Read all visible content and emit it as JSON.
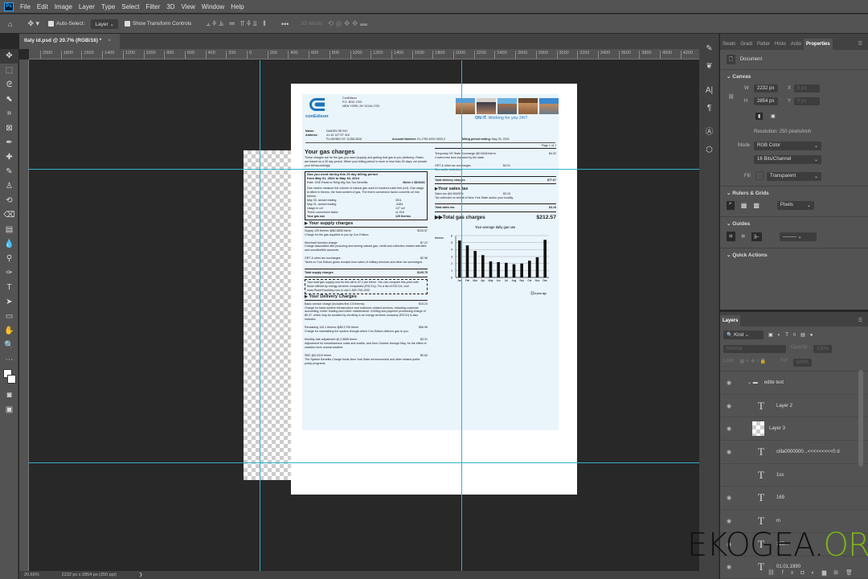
{
  "menu": [
    "File",
    "Edit",
    "Image",
    "Layer",
    "Type",
    "Select",
    "Filter",
    "3D",
    "View",
    "Window",
    "Help"
  ],
  "options": {
    "auto_select": "Auto-Select:",
    "layer_select": "Layer",
    "show_transform": "Show Transform Controls",
    "mode_3d": "3D Mode:",
    "more": "•••"
  },
  "doc_tab": {
    "title": "Italy id.psd @ 20.7% (RGB/16) *",
    "close": "×"
  },
  "ruler_top": [
    "2000",
    "1800",
    "1600",
    "1400",
    "1200",
    "1000",
    "800",
    "600",
    "400",
    "200",
    "0",
    "200",
    "400",
    "600",
    "800",
    "1000",
    "1200",
    "1400",
    "1600",
    "1800",
    "2000",
    "2200",
    "2400",
    "2600",
    "2800",
    "3000",
    "3200",
    "3400",
    "3600",
    "3800",
    "4000",
    "4200"
  ],
  "status": {
    "zoom": "20.66%",
    "size": "2232 px x 2854 px (250 ppi)",
    "arrow": "❯"
  },
  "bill": {
    "company": "ConEdison",
    "pobox": "P.O. BOX 1702",
    "city": "NEW YORK, NY 10116-1702",
    "logo": "conEdison",
    "slogan_bold": "ON IT.",
    "slogan": "Working for you 24/7.",
    "name_label": "Name:",
    "name": "DAIDEN SE INC",
    "address_label": "Address:",
    "address1": "41-43 147 ST 418",
    "address2": "FLUSHING NY 11358-2626",
    "account_label": "Account Number:",
    "account": "01-1750-4002-0003-0",
    "billing_label": "Billing period ending:",
    "billing": "May 30, 2024",
    "page": "Page 1 of 1",
    "gas_title": "Your gas charges",
    "gas_intro": "These charges are for the gas you used (supply) and getting that gas to you (delivery). Rates are based on a 30 day period. When your billing period is more or less than 30 days, we prorate your bill accordingly.",
    "box": {
      "title1": "Gas you used during this 29 day billing period",
      "title2": "from May 01, 2024 to May 30, 2024",
      "rate": "Rate: GSE Resid or Relig Htg Svc Svc Benefits",
      "meter": "Meter # 3815431",
      "desc": "Gas meters measure the volume of natural gas used in hundred cubic feet (ccf). Gas usage is billed in therms, the heat content of gas. The therm conversion factor converts ccf into therms.",
      "rows": [
        [
          "May 30, actual reading",
          "3511"
        ],
        [
          "May 01, actual reading",
          "-3384"
        ],
        [
          "Usage in ccf",
          "127 ccf"
        ],
        [
          "Therm conversion factor",
          "x1.018"
        ],
        [
          "Your gas use",
          "129 therms"
        ]
      ]
    },
    "supply_title": "Your supply charges",
    "supply": [
      {
        "l": "Supply 129 therms @$0.5835 therm",
        "v": "$115.57",
        "d": "Charge for the gas supplied to you by Con Edison."
      },
      {
        "l": "Merchant function charge",
        "v": "$7.22",
        "d": "Charge associated with procuring and storing natural gas, credit and collection related activities and uncollectible accounts."
      },
      {
        "l": "GRT & other tax surcharges",
        "v": "$2.96",
        "d": "Taxes on Con Edison gross receipts from sales of military services and other tax surcharges."
      }
    ],
    "supply_total_label": "Total supply charges",
    "supply_total": "$125.75",
    "esco": "Your total gas supply cost for this bill is 97.2 per therm. You can compare this price with those offered by energy services companies (ESCOs). For a list of ESCOs, visit www.PowerYourWay.com or call 1-800-799-1000",
    "delivery_title": "Your Delivery Charges",
    "delivery": [
      {
        "l": "Basic service charge (includes first 2.8 therms)",
        "v": "$15.24",
        "d": "Charge for basic system infrastructure and customer-related services, including customer accounting, meter reading and meter maintenance. A billing and payment processing charge of $0.47, which may be avoided by enrolling in an energy services company (ESCO) is also included."
      },
      {
        "l": "Remaining 126.1 therms @$0.1705 therm",
        "v": "$56.96",
        "d": "Charge for maintaining the system through which Con Edison delivers gas to you."
      },
      {
        "l": "Monthly rate adjustment @-2.5655 therm",
        "v": "$3.31",
        "d": "Adjustment for miscellaneous costs and credits, and from October through May, for the effect of variation from normal weather."
      },
      {
        "l": "SBC @0.0410 therm",
        "v": "$0.64",
        "d": "The System Benefits Charge funds New York State environmental and other related public policy programs."
      }
    ],
    "right": [
      {
        "l": "Temporary NY State Surcharge @0.5408 therm",
        "v": "$4.32",
        "d": "Covers new fees imposed by the state."
      },
      {
        "l": "GRT & other tax surcharges",
        "v": "$4.01",
        "d": "See earlier definition."
      }
    ],
    "delivery_total_label": "Total delivery charges",
    "delivery_total": "$77.67",
    "tax_title": "Your sales tax",
    "tax_line": "Sales tax @4.50000%",
    "tax_val": "$3.15",
    "tax_desc": "Tax collected on behalf of New York State and/or your locality.",
    "tax_total_label": "Total sales tax",
    "tax_total": "$3.15",
    "grand_label": "Total gas charges",
    "grand": "$212.57",
    "legend": "a year ago"
  },
  "chart_data": {
    "type": "bar",
    "title": "Your average daily gas use",
    "ylabel": "therms",
    "categories": [
      "Jan",
      "Feb",
      "Mar",
      "Apr",
      "May",
      "Jun",
      "Jul",
      "Aug",
      "Sep",
      "Oct",
      "Nov",
      "Dec"
    ],
    "values": [
      5.3,
      4.6,
      3.8,
      3.2,
      2.3,
      2.2,
      2.1,
      1.9,
      2.0,
      2.4,
      2.9,
      5.4
    ],
    "ylim": [
      0,
      6
    ],
    "yticks": [
      "0",
      "1",
      "2",
      "3",
      "4",
      "5",
      "6"
    ],
    "grid": true
  },
  "props": {
    "tabs": [
      "Swatc",
      "Gradi",
      "Patter",
      "Histo",
      "Actio",
      "Properties"
    ],
    "doc": "Document",
    "canvas": "Canvas",
    "w_label": "W",
    "w": "2232 px",
    "h_label": "H",
    "h": "2854 px",
    "x_label": "X",
    "x": "0 px",
    "y_label": "Y",
    "y": "0 px",
    "resolution": "Resolution: 250 pixels/inch",
    "mode_label": "Mode",
    "mode": "RGB Color",
    "depth": "16 Bits/Channel",
    "fill_label": "Fill",
    "fill": "Transparent",
    "rulers": "Rulers & Grids",
    "units": "Pixels",
    "guides": "Guides",
    "quick": "Quick Actions"
  },
  "layers": {
    "title": "Layers",
    "kind": "Kind",
    "blend": "Normal",
    "opacity_label": "Opacity:",
    "opacity": "100%",
    "lock_label": "Lock:",
    "fill_label": "Fill:",
    "fill": "100%",
    "items": [
      {
        "name": "edite text",
        "type": "group"
      },
      {
        "name": "Layer 2",
        "type": "text"
      },
      {
        "name": "Layer 3",
        "type": "image"
      },
      {
        "name": "cilla0000000...<<<<<<<<<0 d",
        "type": "text"
      },
      {
        "name": "1ss",
        "type": "text",
        "hidden": true
      },
      {
        "name": "169",
        "type": "text"
      },
      {
        "name": "m",
        "type": "text"
      },
      {
        "name": "125...",
        "type": "text"
      },
      {
        "name": "01.01.1990",
        "type": "text"
      }
    ]
  },
  "watermark": {
    "a": "EKOGEA.",
    "b": "ORG"
  }
}
